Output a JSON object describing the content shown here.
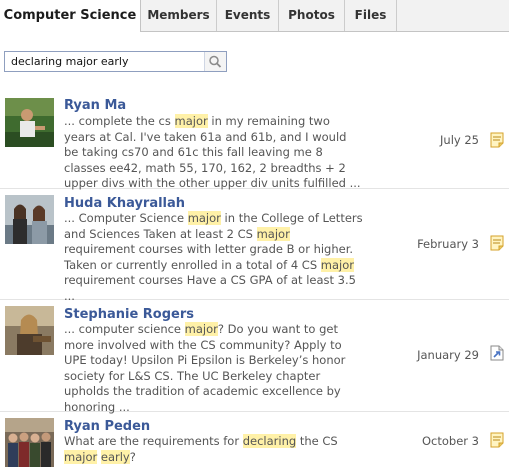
{
  "tabs": [
    {
      "label": "Computer Science",
      "active": true
    },
    {
      "label": "Members"
    },
    {
      "label": "Events"
    },
    {
      "label": "Photos"
    },
    {
      "label": "Files"
    }
  ],
  "search": {
    "value": "declaring major early",
    "icon": "search-icon"
  },
  "colors": {
    "link": "#3b5998",
    "highlight": "#fff1a8",
    "note_icon": "#e4b83a",
    "share_icon": "#4a74c4"
  },
  "results": [
    {
      "name": "Ryan Ma",
      "snippet": [
        {
          "t": "... complete the cs "
        },
        {
          "t": "major",
          "h": true
        },
        {
          "t": " in my remaining two years at Cal. I've taken 61a and 61b, and I would be taking cs70 and 61c this fall leaving me 8 classes ee42, math 55, 170, 162, 2 breadths + 2 upper divs with the other upper div units fulfilled ..."
        }
      ],
      "date": "July 25",
      "icon": "note-icon"
    },
    {
      "name": "Huda Khayrallah",
      "snippet": [
        {
          "t": "... Computer Science "
        },
        {
          "t": "major",
          "h": true
        },
        {
          "t": " in the College of Letters and Sciences Taken at least 2 CS "
        },
        {
          "t": "major",
          "h": true
        },
        {
          "t": " requirement courses with letter grade B or higher. Taken or currently enrolled in a total of 4 CS "
        },
        {
          "t": "major",
          "h": true
        },
        {
          "t": " requirement courses Have a CS GPA of at least 3.5 ..."
        }
      ],
      "date": "February 3",
      "icon": "note-icon"
    },
    {
      "name": "Stephanie Rogers",
      "snippet": [
        {
          "t": "... computer science "
        },
        {
          "t": "major",
          "h": true
        },
        {
          "t": "? Do you want to get more involved with the CS community? Apply to UPE today! Upsilon Pi Epsilon is Berkeley’s honor society for L&S CS. The UC Berkeley chapter upholds the tradition of academic excellence by honoring ..."
        }
      ],
      "date": "January 29",
      "icon": "shared-doc-icon"
    },
    {
      "name": "Ryan Peden",
      "snippet": [
        {
          "t": "What are the requirements for "
        },
        {
          "t": "declaring",
          "h": true
        },
        {
          "t": " the CS "
        },
        {
          "t": "major",
          "h": true
        },
        {
          "t": " "
        },
        {
          "t": "early",
          "h": true
        },
        {
          "t": "?"
        }
      ],
      "date": "October 3",
      "icon": "note-icon"
    }
  ]
}
